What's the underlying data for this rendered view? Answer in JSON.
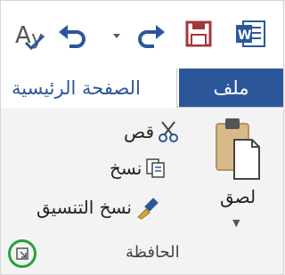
{
  "quick_access": {
    "icons": [
      "spelling-icon",
      "undo-icon",
      "undo-dropdown-icon",
      "redo-icon",
      "save-icon",
      "word-app-icon"
    ]
  },
  "tabs": {
    "file_label": "ملف",
    "home_label": "الصفحة الرئيسية"
  },
  "clipboard": {
    "cut_label": "قص",
    "copy_label": "نسخ",
    "format_painter_label": "نسخ التنسيق",
    "paste_label": "لصق",
    "group_label": "الحافظة"
  },
  "colors": {
    "accent": "#2b579a",
    "launcher_highlight": "#2aa03c"
  }
}
